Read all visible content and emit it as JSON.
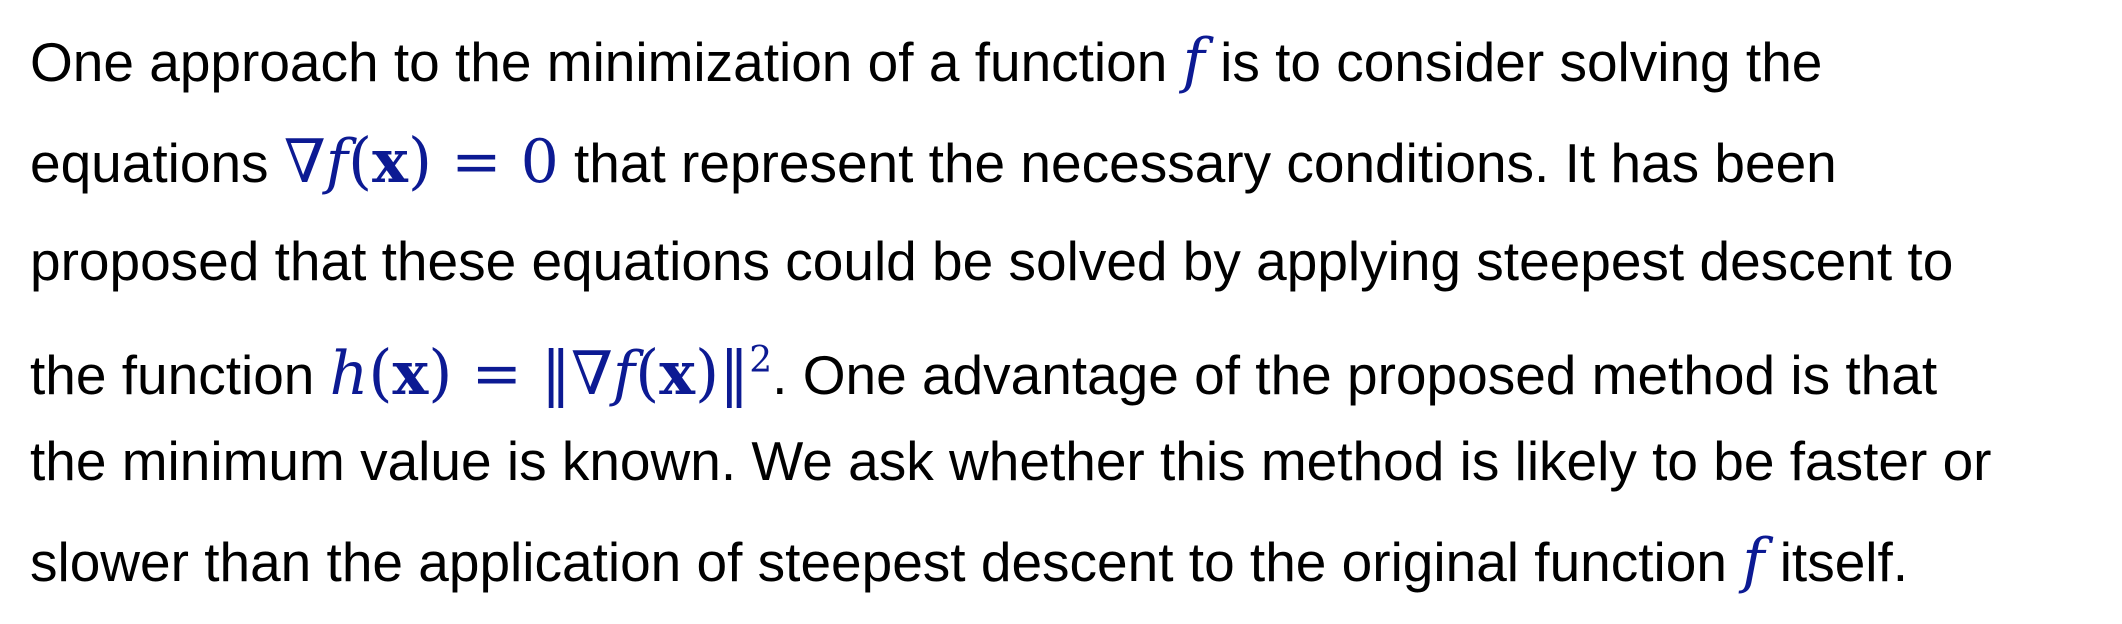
{
  "paragraph": {
    "line1": {
      "a": "One approach to the minimization of a function",
      "b": "is to consider solving the"
    },
    "line2": {
      "a": "equations",
      "b": "that represent the necessary conditions. It has been"
    },
    "line3": {
      "a": "proposed that these equations could be solved by applying steepest descent to"
    },
    "line4": {
      "a": "the function",
      "b": ". One advantage of the proposed method is that"
    },
    "line5": {
      "a": "the minimum value is known. We ask whether this method is likely to be faster or"
    },
    "line6": {
      "a": "slower than the application of steepest descent to the original function",
      "b": "itself."
    }
  },
  "math": {
    "f": "f",
    "grad_eq": {
      "nabla": "∇",
      "f": "f",
      "lp": "(",
      "x": "x",
      "rp": ")",
      "eq": "=",
      "zero": "0"
    },
    "h_eq": {
      "h": "h",
      "lp": "(",
      "x": "x",
      "rp": ")",
      "eq": "=",
      "lnorm": "‖",
      "nabla": "∇",
      "f": "f",
      "lp2": "(",
      "x2": "x",
      "rp2": ")",
      "rnorm": "‖",
      "exp": "2"
    }
  },
  "colors": {
    "text": "#000000",
    "math": "#0c1a93",
    "background": "#ffffff"
  }
}
